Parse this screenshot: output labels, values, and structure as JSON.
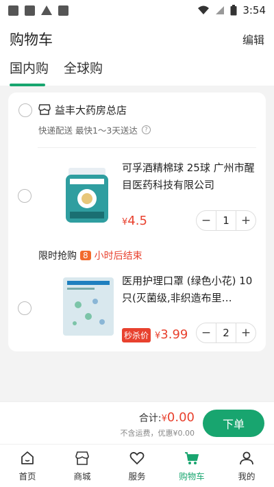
{
  "status_bar": {
    "time": "3:54"
  },
  "header": {
    "title": "购物车",
    "edit_label": "编辑"
  },
  "tabs": [
    {
      "label": "国内购",
      "active": true
    },
    {
      "label": "全球购",
      "active": false
    }
  ],
  "store": {
    "name": "益丰大药房总店",
    "delivery": "快递配送 最快1～3天送达"
  },
  "items": [
    {
      "name": "可孚酒精棉球 25球 广州市醒目医药科技有限公司",
      "currency": "¥",
      "price": "4.5",
      "quantity": "1"
    },
    {
      "name": "医用护理口罩 (绿色小花) 10只(灭菌级,非织造布里…",
      "badge": "秒杀价",
      "currency": "¥",
      "price": "3.99",
      "quantity": "2"
    }
  ],
  "flash_sale": {
    "label": "限时抢购",
    "hours": "8",
    "suffix": "小时后结束"
  },
  "checkout": {
    "total_label": "合计:",
    "currency": "¥",
    "total": "0.00",
    "note": "不含运费，优惠¥0.00",
    "order_button": "下单"
  },
  "bottom_nav": [
    {
      "label": "首页",
      "icon": "home-icon"
    },
    {
      "label": "商城",
      "icon": "store-icon"
    },
    {
      "label": "服务",
      "icon": "heart-icon"
    },
    {
      "label": "购物车",
      "icon": "cart-icon",
      "active": true
    },
    {
      "label": "我的",
      "icon": "user-icon"
    }
  ],
  "colors": {
    "accent": "#18a56f",
    "price": "#e8412e",
    "flash": "#f26a2c"
  }
}
